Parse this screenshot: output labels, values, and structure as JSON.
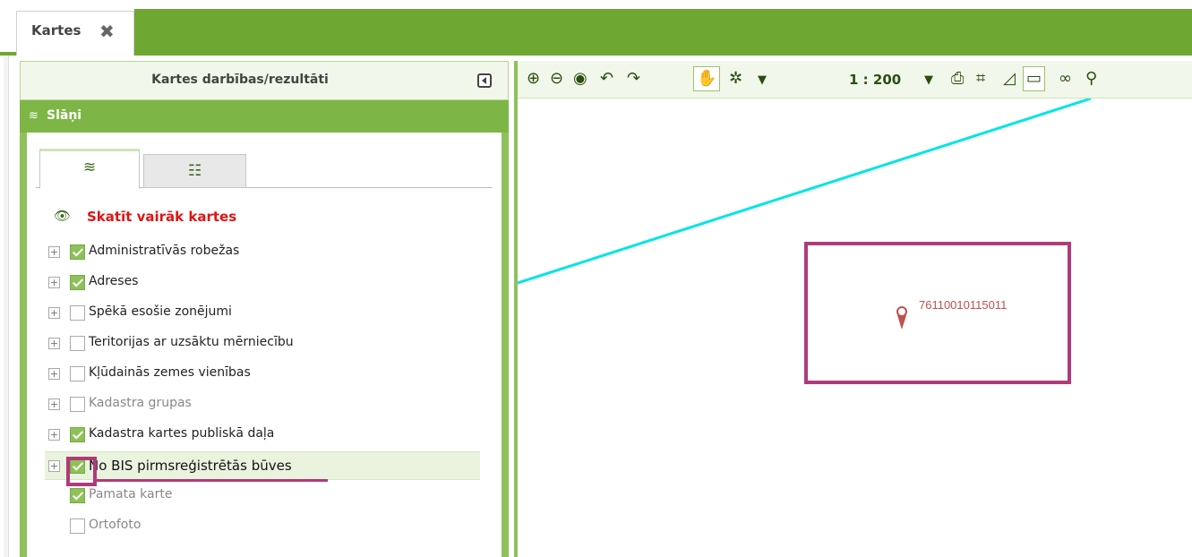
{
  "top_tab": {
    "label": "Kartes",
    "close_icon": "close-icon"
  },
  "left_panel": {
    "title": "Kartes darbības/rezultāti",
    "collapse_icon": "collapse-left-icon",
    "section_title": "Slāņi",
    "section_icon": "layers-icon",
    "tabs": [
      {
        "icon": "layers-icon",
        "active": true
      },
      {
        "icon": "list-icon",
        "active": false
      }
    ],
    "more_maps_label": "Skatīt vairāk kartes",
    "layers": [
      {
        "label": "Administratīvās robežas",
        "checked": true,
        "expandable": true,
        "muted": false
      },
      {
        "label": "Adreses",
        "checked": true,
        "expandable": true,
        "muted": false
      },
      {
        "label": "Spēkā esošie zonējumi",
        "checked": false,
        "expandable": true,
        "muted": false
      },
      {
        "label": "Teritorijas ar uzsāktu mērniecību",
        "checked": false,
        "expandable": true,
        "muted": false
      },
      {
        "label": "Kļūdainās zemes vienības",
        "checked": false,
        "expandable": true,
        "muted": false
      },
      {
        "label": "Kadastra grupas",
        "checked": false,
        "expandable": true,
        "muted": true
      },
      {
        "label": "Kadastra kartes publiskā daļa",
        "checked": true,
        "expandable": true,
        "muted": false
      },
      {
        "label": "No BIS pirmsreģistrētās būves",
        "checked": true,
        "expandable": true,
        "muted": false,
        "highlighted": true
      },
      {
        "label": "Pamata karte",
        "checked": true,
        "expandable": false,
        "muted": true
      },
      {
        "label": "Ortofoto",
        "checked": false,
        "expandable": false,
        "muted": true
      }
    ]
  },
  "map_toolbar": {
    "scale": "1 : 200",
    "tools": [
      "zoom-in-icon",
      "zoom-out-icon",
      "globe-icon",
      "undo-icon",
      "redo-icon",
      "pan-hand-icon",
      "select-icon",
      "dropdown-icon",
      "scale-dropdown-icon",
      "print-icon",
      "coordinates-icon",
      "measure-icon",
      "comment-icon",
      "link-icon",
      "edit-link-icon"
    ]
  },
  "map": {
    "parcel_code": "76110010115011",
    "line_color": "#00e5e5",
    "marker_color": "#c0504d",
    "highlight_color": "#b03a7a"
  }
}
